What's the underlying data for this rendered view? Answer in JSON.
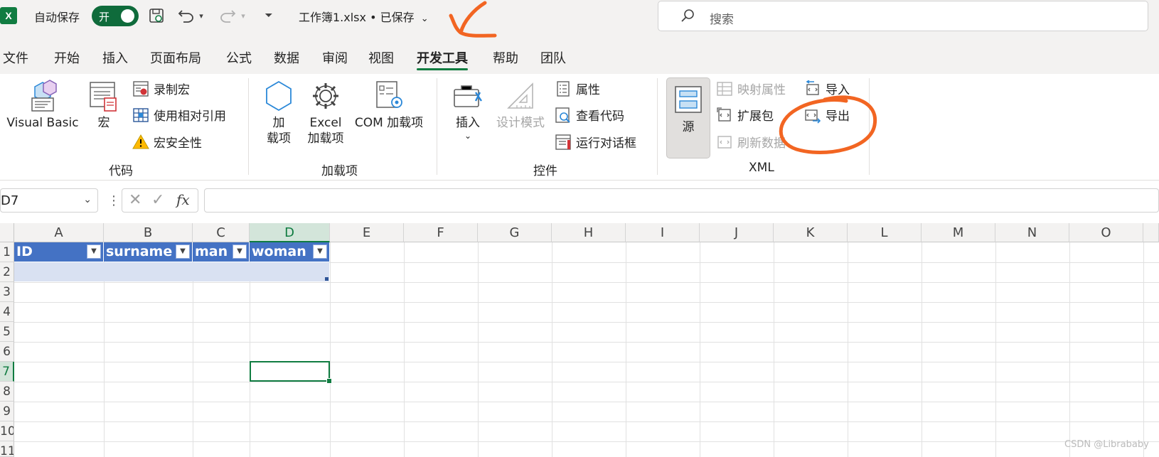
{
  "titlebar": {
    "app_icon": "X",
    "autosave_label": "自动保存",
    "toggle_label": "开",
    "document_title": "工作簿1.xlsx • 已保存",
    "search_placeholder": "搜索"
  },
  "tabs": [
    "文件",
    "开始",
    "插入",
    "页面布局",
    "公式",
    "数据",
    "审阅",
    "视图",
    "开发工具",
    "帮助",
    "团队"
  ],
  "active_tab": "开发工具",
  "ribbon": {
    "code": {
      "label": "代码",
      "visual_basic": "Visual Basic",
      "macros": "宏",
      "record_macro": "录制宏",
      "relative_refs": "使用相对引用",
      "macro_security": "宏安全性"
    },
    "addins": {
      "label": "加载项",
      "addins_line1": "加",
      "addins_line2": "载项",
      "excel_addins_line1": "Excel",
      "excel_addins_line2": "加载项",
      "com_addins": "COM 加载项"
    },
    "controls": {
      "label": "控件",
      "insert": "插入",
      "design_mode": "设计模式",
      "properties": "属性",
      "view_code": "查看代码",
      "run_dialog": "运行对话框"
    },
    "xml": {
      "label": "XML",
      "source": "源",
      "map_properties": "映射属性",
      "expansion_packs": "扩展包",
      "refresh_data": "刷新数据",
      "import": "导入",
      "export": "导出"
    }
  },
  "formula_bar": {
    "name_box": "D7",
    "formula": ""
  },
  "grid": {
    "columns": [
      "A",
      "B",
      "C",
      "D",
      "E",
      "F",
      "G",
      "H",
      "I",
      "J",
      "K",
      "L",
      "M",
      "N",
      "O"
    ],
    "rows": [
      "1",
      "2",
      "3",
      "4",
      "5",
      "6",
      "7",
      "8",
      "9",
      "10",
      "11"
    ],
    "table_headers": [
      "ID",
      "surname",
      "man",
      "woman"
    ],
    "selected_cell": "D7"
  },
  "colors": {
    "excel_green": "#107c41",
    "table_header": "#4472c4",
    "table_band": "#d9e1f2",
    "annotation": "#f26522"
  },
  "watermark": "CSDN @Librababy"
}
